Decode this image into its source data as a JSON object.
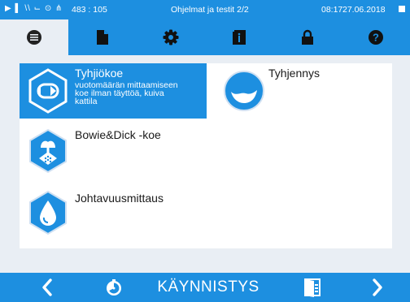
{
  "status_bar": {
    "icons_text": "▶ ▌ \\\\ ⌙ ⊙ ⋔",
    "coordinates": "483 : 105",
    "title": "Ohjelmat ja testit 2/2",
    "time": "08:17",
    "date": "27.06.2018"
  },
  "tabs": [
    {
      "icon": "list-icon",
      "active": true
    },
    {
      "icon": "document-icon",
      "active": false
    },
    {
      "icon": "gear-icon",
      "active": false
    },
    {
      "icon": "info-book-icon",
      "active": false
    },
    {
      "icon": "lock-icon",
      "active": false
    },
    {
      "icon": "help-icon",
      "active": false
    }
  ],
  "programs": [
    {
      "label": "Tyhjiökoe",
      "description": [
        "vuotomäärän mittaamiseen",
        "koe ilman täyttöä, kuiva",
        "kattila"
      ],
      "selected": true,
      "icon": "vacuum-test-icon"
    },
    {
      "label": "Tyhjennys",
      "selected": false,
      "icon": "drain-icon"
    },
    {
      "label": "Bowie&Dick -koe",
      "selected": false,
      "icon": "bowie-dick-icon"
    },
    {
      "label": "Johtavuusmittaus",
      "selected": false,
      "icon": "conductivity-icon"
    }
  ],
  "bottom_bar": {
    "start_label": "KÄYNNISTYS",
    "icons": [
      "chevron-left-icon",
      "timer-icon",
      "door-icon",
      "chevron-right-icon"
    ]
  },
  "colors": {
    "accent": "#1d8fe0",
    "background": "#e9eef4",
    "panel": "#ffffff"
  }
}
